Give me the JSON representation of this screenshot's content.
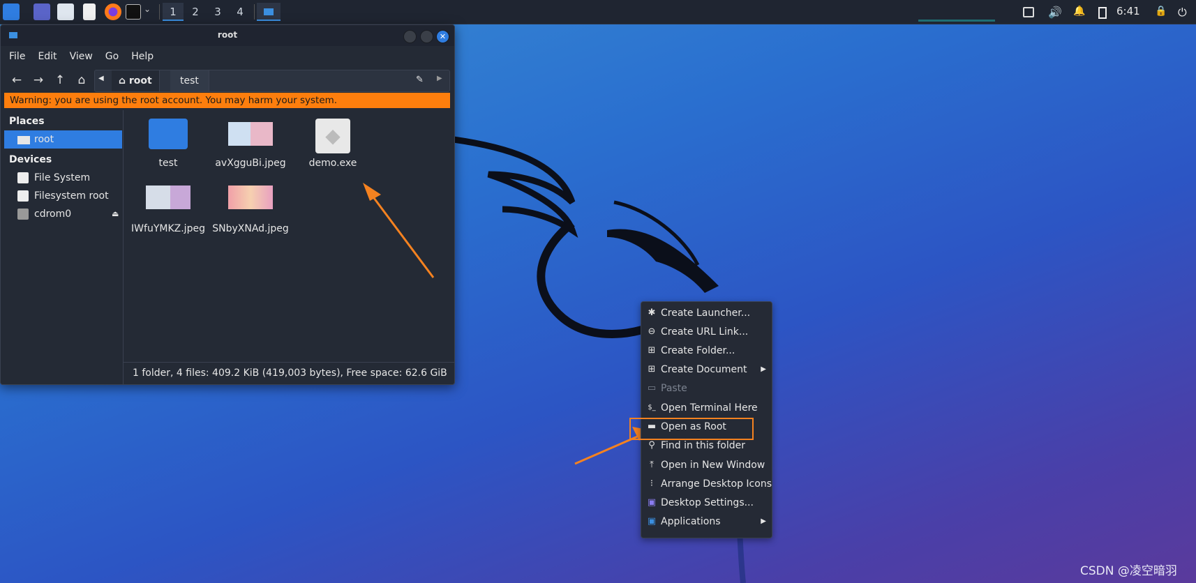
{
  "taskbar": {
    "workspaces": [
      "1",
      "2",
      "3",
      "4"
    ],
    "clock": "6:41"
  },
  "window": {
    "title": "root",
    "menu": [
      "File",
      "Edit",
      "View",
      "Go",
      "Help"
    ],
    "path": [
      "root",
      "test"
    ],
    "warning": "Warning: you are using the root account. You may harm your system.",
    "sidebar": {
      "places_title": "Places",
      "places": [
        "root"
      ],
      "devices_title": "Devices",
      "devices": [
        "File System",
        "Filesystem root",
        "cdrom0"
      ]
    },
    "files": [
      {
        "name": "test",
        "type": "folder"
      },
      {
        "name": "avXgguBi.jpeg",
        "type": "image"
      },
      {
        "name": "demo.exe",
        "type": "exe"
      },
      {
        "name": "IWfuYMKZ.jpeg",
        "type": "image"
      },
      {
        "name": "SNbyXNAd.jpeg",
        "type": "image"
      }
    ],
    "status": "1 folder, 4 files: 409.2 KiB (419,003 bytes), Free space: 62.6 GiB"
  },
  "context_menu": {
    "items": [
      {
        "label": "Create Launcher...",
        "icon": "gear-icon"
      },
      {
        "label": "Create URL Link...",
        "icon": "link-icon"
      },
      {
        "label": "Create Folder...",
        "icon": "new-folder-icon"
      },
      {
        "label": "Create Document",
        "icon": "new-document-icon",
        "submenu": true
      },
      {
        "label": "Paste",
        "icon": "clipboard-icon",
        "disabled": true
      },
      {
        "label": "Open Terminal Here",
        "icon": "terminal-icon"
      },
      {
        "label": "Open as Root",
        "icon": "folder-icon"
      },
      {
        "label": "Find in this folder",
        "icon": "search-icon"
      },
      {
        "label": "Open in New Window",
        "icon": "upload-icon"
      },
      {
        "label": "Arrange Desktop Icons",
        "icon": "arrange-icon"
      },
      {
        "label": "Desktop Settings...",
        "icon": "settings-icon"
      },
      {
        "label": "Applications",
        "icon": "applications-icon",
        "submenu": true
      }
    ]
  },
  "watermark": "CSDN @凌空暗羽",
  "colors": {
    "warning_bg": "#fd7e0d",
    "selection": "#2f7de1",
    "annotation": "#f58220"
  }
}
